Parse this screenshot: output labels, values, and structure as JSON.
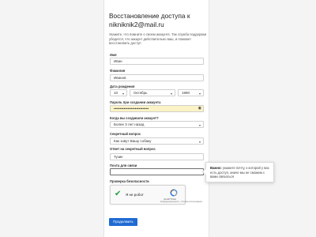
{
  "page": {
    "title": "Восстановление доступа к nikniknik2@mail.ru",
    "intro": "Укажите, что помните о своем аккаунте. Так служба поддержки убедится, что аккаунт действительно ваш, и поможет восстановить доступ"
  },
  "form": {
    "first_name": {
      "label": "Имя",
      "value": "Иван"
    },
    "last_name": {
      "label": "Фамилия",
      "value": "Иванов"
    },
    "birth_date": {
      "label": "Дата рождения",
      "day": "10",
      "month": "Октябрь",
      "year": "1980"
    },
    "password": {
      "label": "Пароль при создании аккаунта",
      "value": "••••••••••••••••••••••••••••"
    },
    "created": {
      "label": "Когда вы создавали аккаунт?",
      "value": "Более 3 лет назад"
    },
    "secret_question": {
      "label": "Секретный вопрос",
      "value": "Как зовут Вашу собаку"
    },
    "secret_answer": {
      "label": "Ответ на секретный вопрос",
      "value": "Тузик"
    },
    "contact_email": {
      "label": "Почта для связи",
      "value": ""
    },
    "security_check": {
      "label": "Проверка безопасности"
    },
    "submit_label": "Продолжить"
  },
  "captcha": {
    "text": "Я не робот",
    "brand": "reCAPTCHA",
    "terms": "Конфиденциальность - Условия использования"
  },
  "tooltip": {
    "bold": "Важно:",
    "text": "укажите почту, к которой у вас есть доступ, иначе мы не сможем с вами связаться"
  },
  "icons": {
    "dropdown": "chevron-down-icon",
    "password_toggle": "eye-icon",
    "captcha_check": "checkmark-icon",
    "captcha_logo": "recaptcha-logo-icon"
  },
  "colors": {
    "accent": "#1f6bd3",
    "autofill": "#fbf3c6",
    "check": "#1e9d43"
  }
}
